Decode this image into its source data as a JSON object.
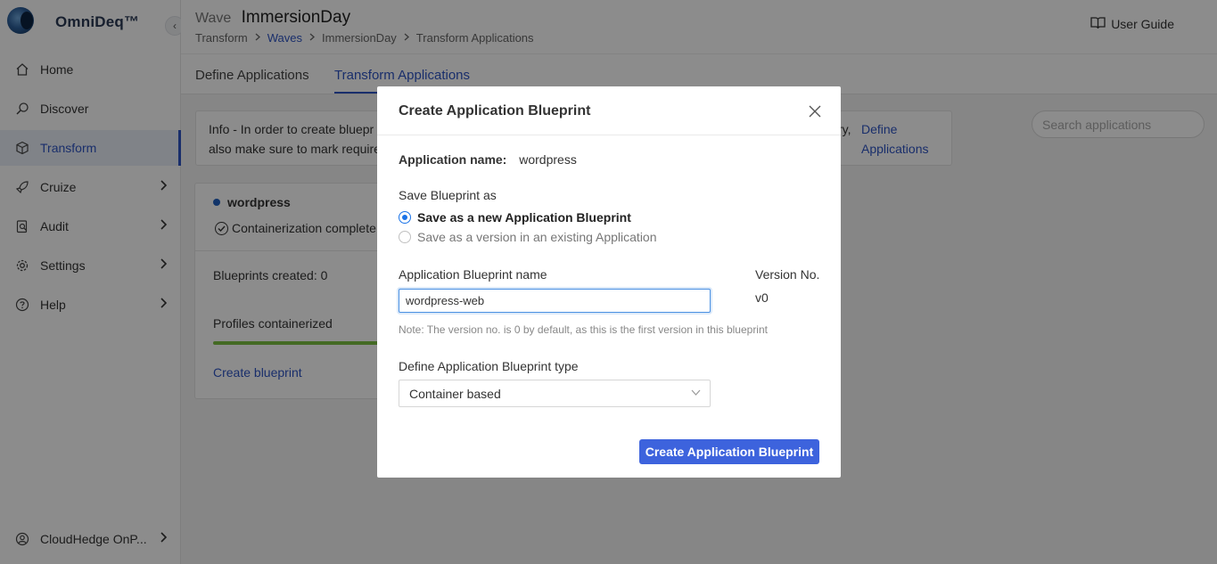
{
  "brand": {
    "name": "OmniDeq™",
    "collapse_icon": "‹"
  },
  "sidebar": {
    "items": [
      {
        "label": "Home",
        "icon": "home-icon",
        "has_chevron": false
      },
      {
        "label": "Discover",
        "icon": "discover-icon",
        "has_chevron": false
      },
      {
        "label": "Transform",
        "icon": "cube-icon",
        "has_chevron": false,
        "active": true
      },
      {
        "label": "Cruize",
        "icon": "rocket-icon",
        "has_chevron": true
      },
      {
        "label": "Audit",
        "icon": "audit-icon",
        "has_chevron": true
      },
      {
        "label": "Settings",
        "icon": "gear-icon",
        "has_chevron": true
      },
      {
        "label": "Help",
        "icon": "help-icon",
        "has_chevron": true
      }
    ],
    "footer": {
      "label": "CloudHedge OnP...",
      "icon": "user-icon"
    }
  },
  "header": {
    "wave_label": "Wave",
    "wave_name": "ImmersionDay",
    "breadcrumb": [
      "Transform",
      "Waves",
      "ImmersionDay",
      "Transform Applications"
    ],
    "user_guide": "User Guide"
  },
  "tabs": [
    {
      "label": "Define Applications",
      "active": false
    },
    {
      "label": "Transform Applications",
      "active": true
    }
  ],
  "info": {
    "line1": "Info - In order to create bluepr",
    "line2": "also make sure to mark require",
    "line1_tail": "ry,",
    "link_line1": "Define",
    "link_line2": "Applications"
  },
  "search": {
    "placeholder": "Search applications"
  },
  "app_card": {
    "name": "wordpress",
    "status": "Containerization complete",
    "blueprints_created": "Blueprints created: 0",
    "profiles_containerized": "Profiles containerized",
    "create_link": "Create blueprint",
    "progress_fraction": 1.0
  },
  "modal": {
    "title": "Create Application Blueprint",
    "app_name_key": "Application name:",
    "app_name_value": "wordpress",
    "save_as_label": "Save Blueprint as",
    "option_new": "Save as a new Application Blueprint",
    "option_version": "Save as a version in an existing Application",
    "bp_name_label": "Application Blueprint name",
    "bp_name_value": "wordpress-web",
    "version_label": "Version No.",
    "version_value": "v0",
    "note": "Note: The version no. is 0 by default, as this is the first version in this blueprint",
    "type_label": "Define Application Blueprint type",
    "type_value": "Container based",
    "submit": "Create Application Blueprint"
  },
  "colors": {
    "accent": "#2f55c4",
    "button": "#3d63dd",
    "progress": "#7cc242"
  }
}
